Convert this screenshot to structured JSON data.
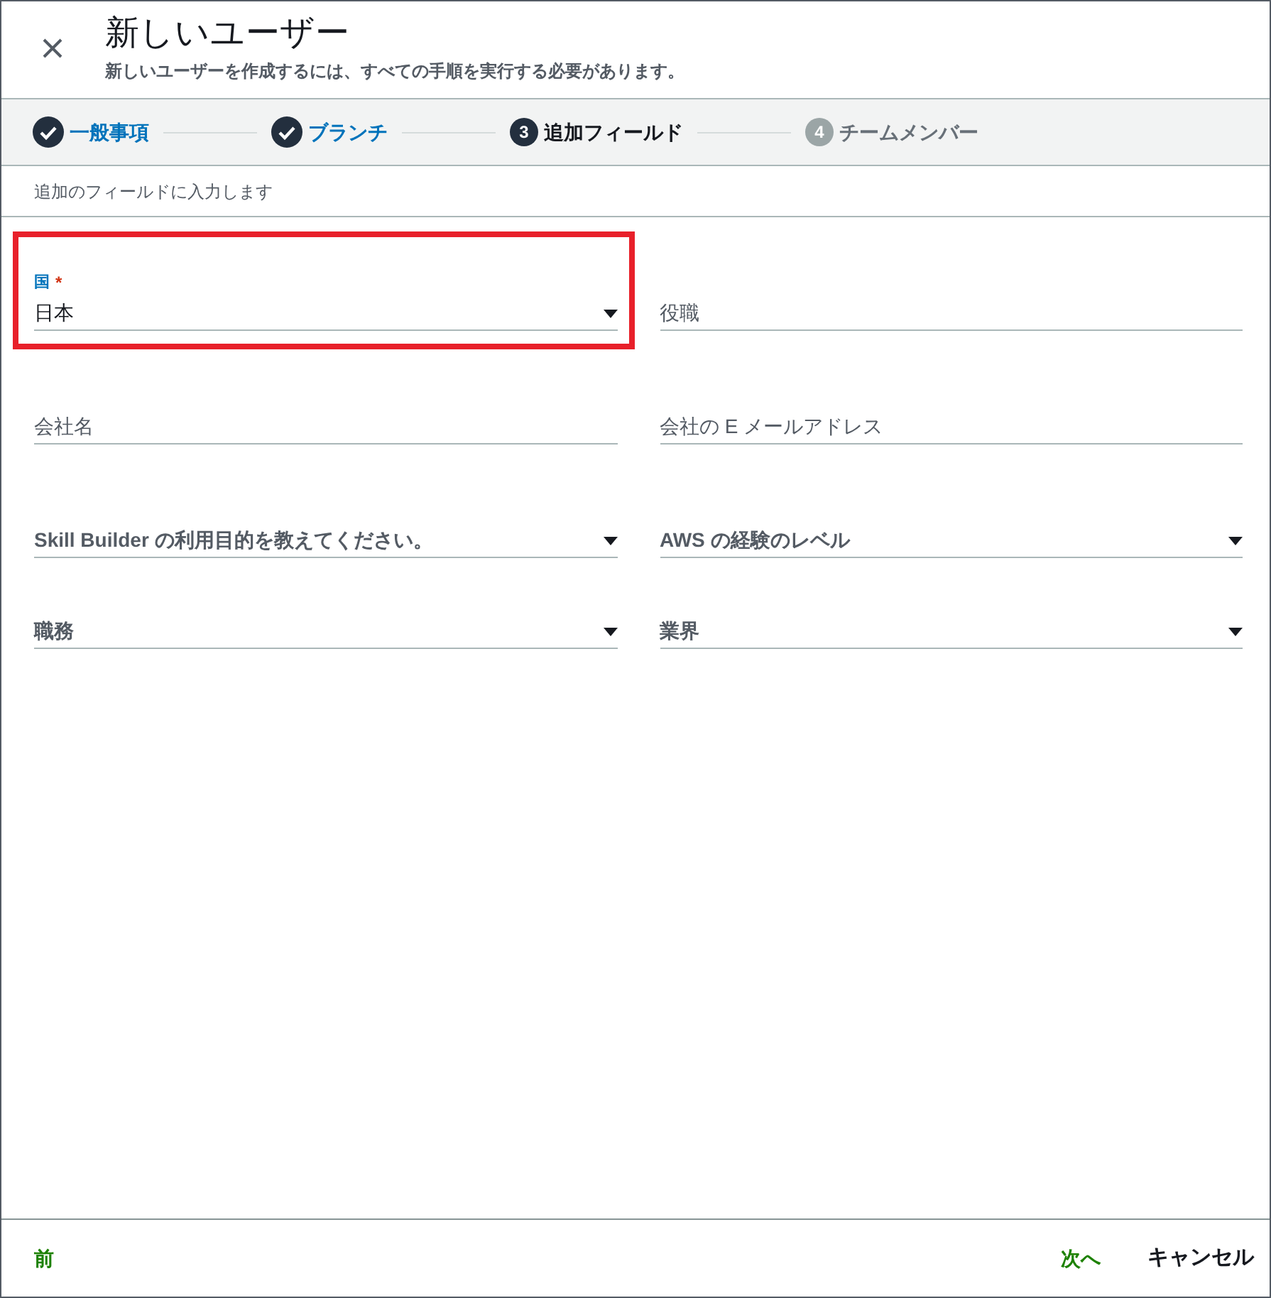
{
  "dialog": {
    "title": "新しいユーザー",
    "subtitle": "新しいユーザーを作成するには、すべての手順を実行する必要があります。"
  },
  "steps": [
    {
      "label": "一般事項",
      "completed": true,
      "selected": false
    },
    {
      "label": "ブランチ",
      "completed": true,
      "selected": false
    },
    {
      "number": "3",
      "label": "追加フィールド",
      "completed": false,
      "selected": true
    },
    {
      "number": "4",
      "label": "チームメンバー",
      "completed": false,
      "selected": false
    }
  ],
  "section_hint": "追加のフィールドに入力します",
  "fields": [
    {
      "kind": "select",
      "label": "国",
      "required_mark": "*",
      "value": "日本",
      "highlighted": true
    },
    {
      "kind": "text",
      "placeholder": "役職",
      "highlighted": false
    },
    {
      "kind": "text",
      "placeholder": "会社名",
      "highlighted": false
    },
    {
      "kind": "text",
      "placeholder": "会社の E メールアドレス",
      "highlighted": false
    },
    {
      "kind": "select",
      "placeholder": "Skill Builder の利用目的を教えてください。",
      "highlighted": false
    },
    {
      "kind": "select",
      "placeholder": "AWS の経験のレベル",
      "highlighted": false
    },
    {
      "kind": "select",
      "placeholder": "職務",
      "highlighted": false
    },
    {
      "kind": "select",
      "placeholder": "業界",
      "highlighted": false
    }
  ],
  "footer": {
    "previous": "前",
    "next": "次へ",
    "cancel": "キャンセル"
  }
}
